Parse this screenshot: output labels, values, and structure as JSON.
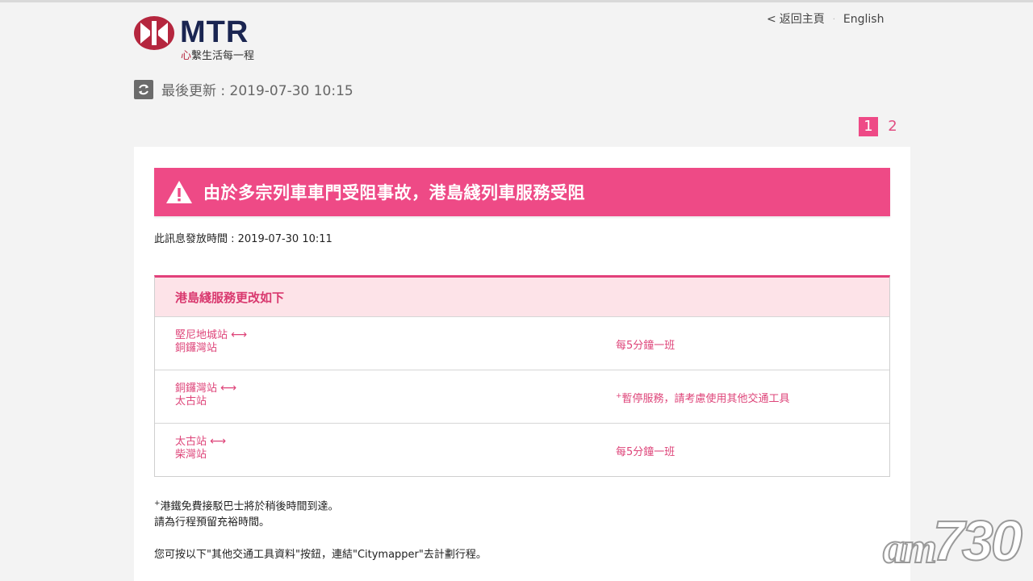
{
  "brand": {
    "name": "MTR",
    "tagline_heart": "心",
    "tagline_rest": "繫生活每一程",
    "primary_color": "#ee4a86",
    "logo_color": "#b5263e"
  },
  "header": {
    "back_label": "返回主頁",
    "separator": "·",
    "language_label": "English"
  },
  "status": {
    "last_updated": "最後更新 : 2019-07-30 10:15"
  },
  "pagination": {
    "pages": [
      "1",
      "2"
    ],
    "active_page": "1"
  },
  "alert": {
    "title": "由於多宗列車車門受阻事故，港島綫列車服務受阻",
    "issued": "此訊息發放時間 : 2019-07-30 10:11"
  },
  "service": {
    "heading": "港島綫服務更改如下",
    "arrow": "⟷",
    "rows": [
      {
        "from": "堅尼地城站",
        "to": "銅鑼灣站",
        "note_marker": "",
        "frequency": "每5分鐘一班"
      },
      {
        "from": "銅鑼灣站",
        "to": "太古站",
        "note_marker": "+",
        "frequency": "暫停服務，請考慮使用其他交通工具"
      },
      {
        "from": "太古站",
        "to": "柴灣站",
        "note_marker": "",
        "frequency": "每5分鐘一班"
      }
    ]
  },
  "notes": {
    "marker": "+",
    "line1": "港鐵免費接駁巴士將於稍後時間到達。",
    "line2": "請為行程預留充裕時間。",
    "cta": "您可按以下\"其他交通工具資料\"按鈕，連結\"Citymapper\"去計劃行程。"
  },
  "watermark": {
    "prefix": "am",
    "number": "730"
  }
}
